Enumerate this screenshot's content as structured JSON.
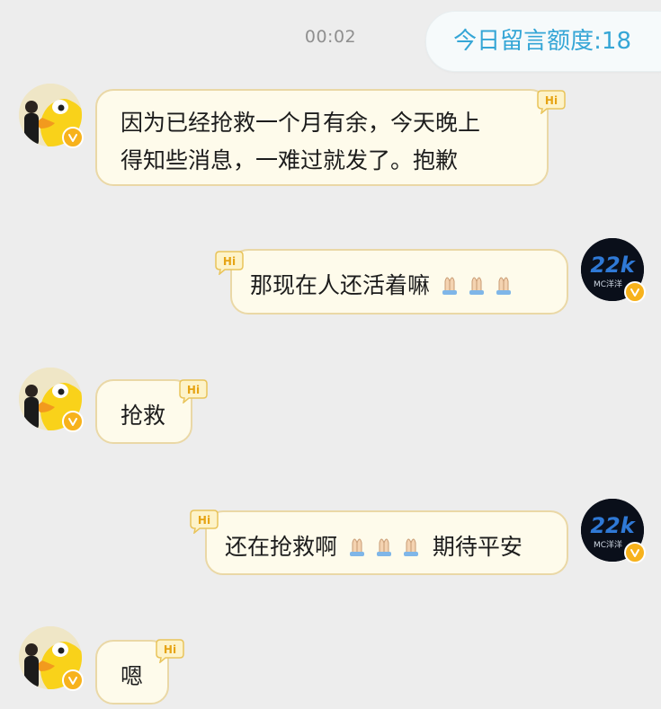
{
  "chat": {
    "timestamp": "00:02",
    "quota_label": "今日留言额度:18",
    "hi_badge": "Hi",
    "avatar_right_label": "MC洋洋",
    "messages": [
      {
        "sender": "left",
        "lines": [
          "因为已经抢救一个月有余，今天晚上",
          "得知些消息，一难过就发了。抱歉"
        ]
      },
      {
        "sender": "right",
        "text": "那现在人还活着嘛",
        "emoji_count": 3
      },
      {
        "sender": "left",
        "text": "抢救"
      },
      {
        "sender": "right",
        "text_before": "还在抢救啊",
        "emoji_count": 3,
        "text_after": "期待平安"
      },
      {
        "sender": "left",
        "text": "嗯"
      }
    ]
  },
  "colors": {
    "background": "#ededed",
    "bubble_fill": "#fefbeb",
    "bubble_border": "#ead8a6",
    "quota_text": "#35a6d6",
    "verified_badge": "#f7b21c"
  },
  "icons": [
    "duck-avatar-icon",
    "mc-logo-avatar-icon",
    "verified-badge-icon",
    "hi-badge-icon",
    "praying-hands-emoji"
  ]
}
